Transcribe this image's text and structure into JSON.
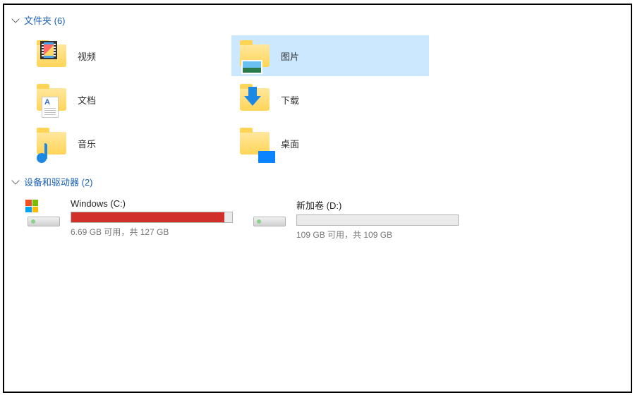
{
  "groups": {
    "folders": {
      "header": "文件夹 (6)",
      "items": [
        {
          "name": "视频"
        },
        {
          "name": "图片"
        },
        {
          "name": "文档"
        },
        {
          "name": "下载"
        },
        {
          "name": "音乐"
        },
        {
          "name": "桌面"
        }
      ]
    },
    "drives": {
      "header": "设备和驱动器 (2)",
      "items": [
        {
          "name": "Windows (C:)",
          "stats": "6.69 GB 可用，共 127 GB",
          "fill_percent": 95,
          "fill_color": "red",
          "os_logo": true
        },
        {
          "name": "新加卷 (D:)",
          "stats": "109 GB 可用，共 109 GB",
          "fill_percent": 0,
          "fill_color": "normal",
          "os_logo": false
        }
      ]
    }
  }
}
